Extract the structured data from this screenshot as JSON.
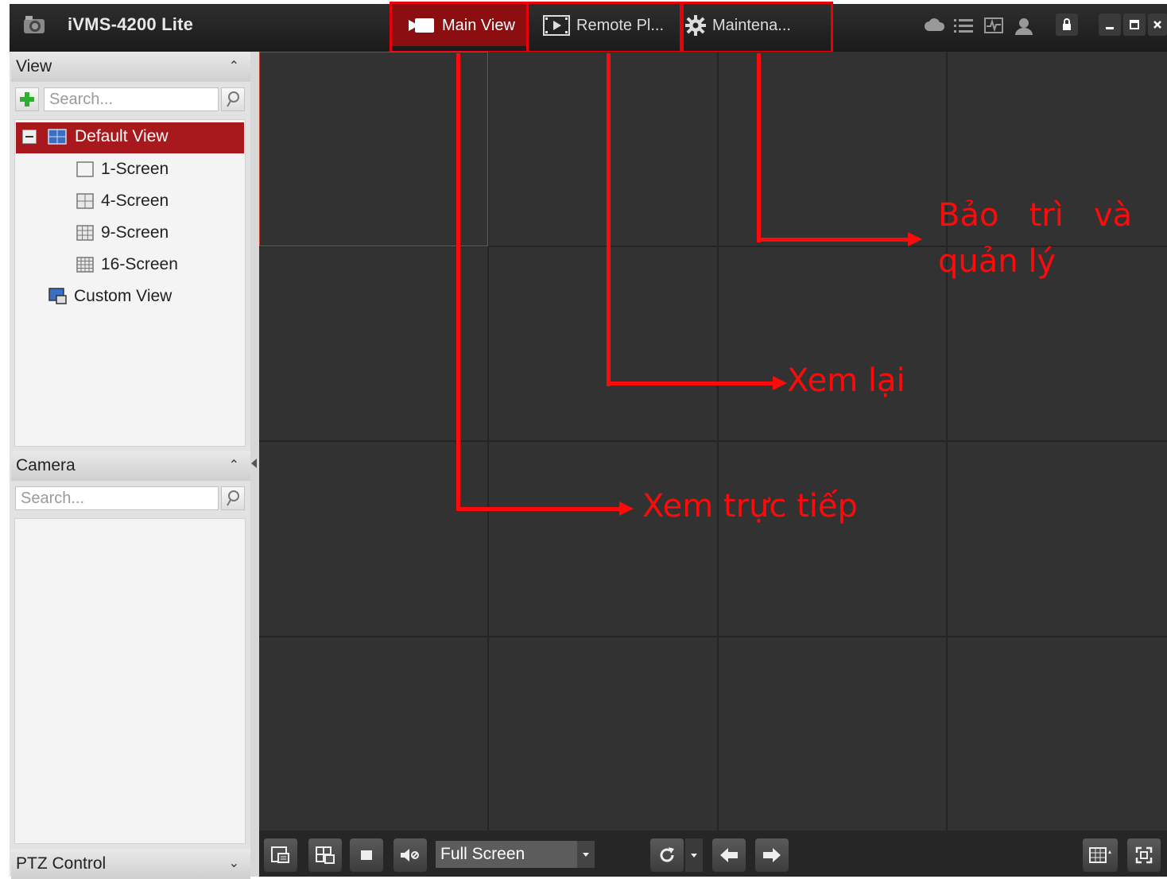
{
  "app": {
    "title": "iVMS-4200 Lite"
  },
  "tabs": [
    {
      "label": "Main View",
      "active": true
    },
    {
      "label": "Remote Pl...",
      "active": false
    },
    {
      "label": "Maintena...",
      "active": false
    }
  ],
  "view_panel": {
    "title": "View",
    "search_placeholder": "Search...",
    "tree": {
      "root": "Default View",
      "children": [
        "1-Screen",
        "4-Screen",
        "9-Screen",
        "16-Screen"
      ],
      "custom": "Custom View"
    }
  },
  "camera_panel": {
    "title": "Camera",
    "search_placeholder": "Search..."
  },
  "ptz_panel": {
    "title": "PTZ Control"
  },
  "toolbar": {
    "mode_select": "Full Screen"
  },
  "annotations": {
    "maintenance": "Bảo   trì   và",
    "maintenance_line2": "quản lý",
    "playback": "Xem lại",
    "live": "Xem trực tiếp"
  },
  "colors": {
    "accent": "#a8191d",
    "annotation": "#ff0a0a",
    "workspace": "#323232"
  }
}
